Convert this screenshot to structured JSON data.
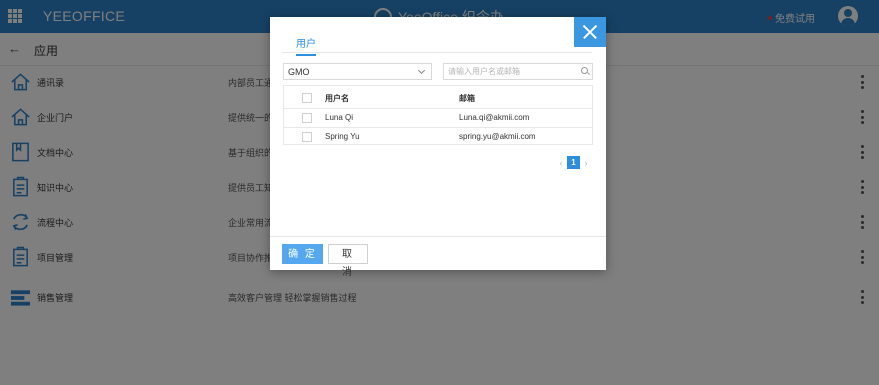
{
  "header": {
    "brand": "YEEOFFICE",
    "center_logo_text": "YeeOffice 织令办",
    "trial_label": "免费试用",
    "colors": {
      "bar": "#2d83c9",
      "accent": "#2d8ee0",
      "trial_dot": "#ff3a3a"
    }
  },
  "subheader": {
    "back_icon": "←",
    "title": "应用"
  },
  "apps": [
    {
      "name": "通讯录",
      "desc": "内部员工通信录",
      "icon": "house-icon"
    },
    {
      "name": "企业门户",
      "desc": "提供统一的企业",
      "icon": "house-icon"
    },
    {
      "name": "文档中心",
      "desc": "基于组织的文",
      "icon": "document-icon"
    },
    {
      "name": "知识中心",
      "desc": "提供员工知识",
      "icon": "clipboard-icon"
    },
    {
      "name": "流程中心",
      "desc": "企业常用流程",
      "icon": "cycle-icon"
    },
    {
      "name": "项目管理",
      "desc": "项目协作推进",
      "icon": "clipboard-icon"
    },
    {
      "name": "销售管理",
      "desc": "高效客户管理 轻松掌握销售过程",
      "icon": "bars-icon"
    }
  ],
  "dialog": {
    "tab": "用户",
    "org_select": "GMO",
    "search_placeholder": "请输入用户名或邮箱",
    "columns": {
      "username": "用户名",
      "email": "邮箱"
    },
    "rows": [
      {
        "username": "Luna Qi",
        "email": "Luna.qi@akmii.com"
      },
      {
        "username": "Spring Yu",
        "email": "spring.yu@akmii.com"
      }
    ],
    "pagination": {
      "prev": "‹",
      "current": "1",
      "next": "›"
    },
    "ok_label": "确 定",
    "cancel_label": "取 消"
  }
}
